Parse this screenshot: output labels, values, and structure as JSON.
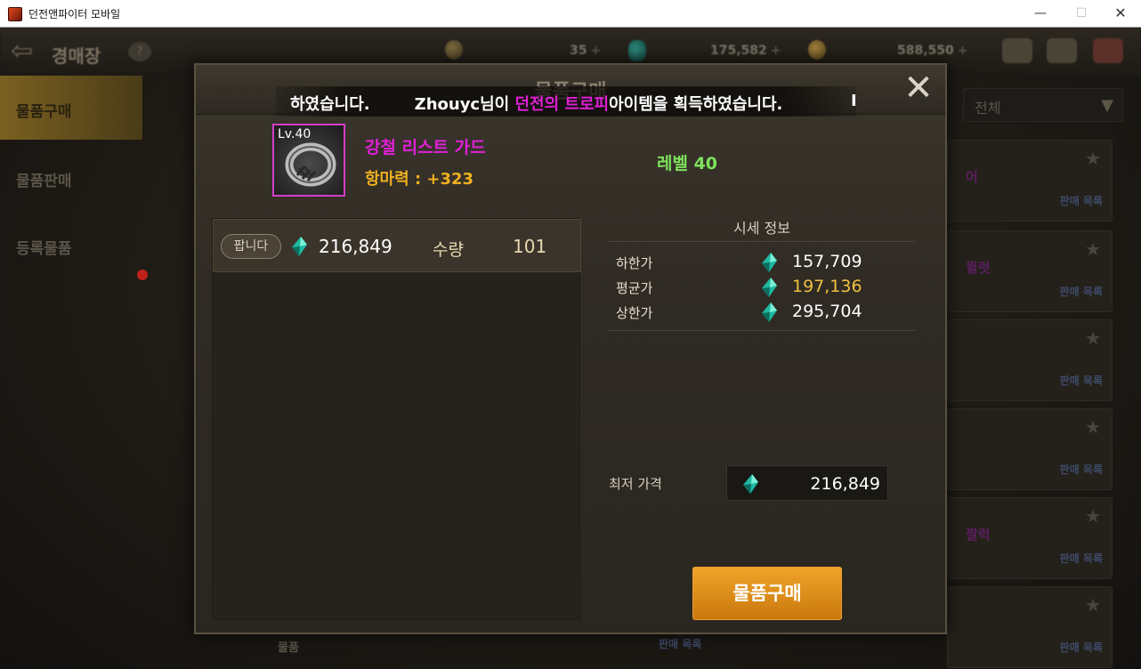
{
  "window": {
    "title": "던전앤파이터 모바일",
    "minimize": "—",
    "maximize": "☐",
    "close": "✕"
  },
  "game": {
    "screen_title": "경매장",
    "help_icon": "?",
    "currencies": [
      {
        "icon": "moon-coin-icon",
        "value": "35"
      },
      {
        "icon": "gem-icon",
        "value": "175,582"
      },
      {
        "icon": "gold-coin-icon",
        "value": "588,550"
      }
    ],
    "plus": "+",
    "left_menu": [
      {
        "label": "물품구매"
      },
      {
        "label": "물품판매"
      },
      {
        "label": "등록물품"
      }
    ],
    "filter": {
      "label": "전체",
      "arrow": "▼"
    },
    "star": "★",
    "row_label": "판매 목록",
    "row_purple_1": "어",
    "row_purple_2": "뮐럿",
    "row_purple_3": "짤럭",
    "bottom_text": "물품"
  },
  "modal": {
    "title": "물품구매",
    "close": "✕",
    "banner": {
      "prefix": "하였습니다.",
      "player": "Zhouyc님이 ",
      "highlight": "던전의 트로피",
      "suffix": "아이템을 획득하였습니다.",
      "tail": "I"
    },
    "item": {
      "level_badge": "Lv.40",
      "name": "강철 리스트 가드",
      "stat": "항마력 : +323",
      "level_text": "레벨 40",
      "frame_color": "#d23fc8",
      "name_color": "#e020d8"
    },
    "listing": {
      "badge": "팝니다",
      "price": "216,849",
      "qty_label": "수량",
      "qty": "101"
    },
    "market": {
      "title": "시세 정보",
      "rows": [
        {
          "label": "하한가",
          "value": "157,709"
        },
        {
          "label": "평균가",
          "value": "197,136"
        },
        {
          "label": "상한가",
          "value": "295,704"
        }
      ]
    },
    "min_price": {
      "label": "최저 가격",
      "value": "216,849"
    },
    "buy_button": "물품구매",
    "colors": {
      "accent": "#f0a42a",
      "average_price": "#f0c040",
      "level": "#7ee25c",
      "stat": "#f0b020"
    }
  }
}
